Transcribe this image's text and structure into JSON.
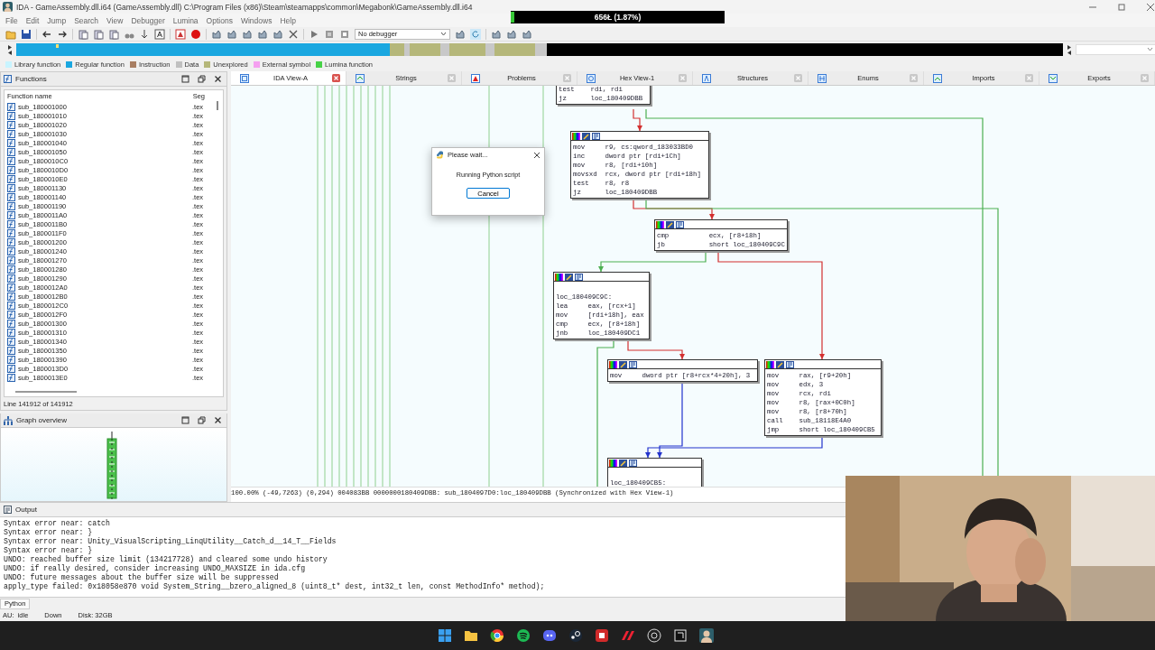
{
  "window": {
    "title": "IDA - GameAssembly.dll.i64 (GameAssembly.dll) C:\\Program Files (x86)\\Steam\\steamapps\\common\\Megabonk\\GameAssembly.dll.i64"
  },
  "overlay_counter": {
    "text": "656Ł (1.87%)",
    "level": 0.0187
  },
  "menu": [
    "File",
    "Edit",
    "Jump",
    "Search",
    "View",
    "Debugger",
    "Lumina",
    "Options",
    "Windows",
    "Help"
  ],
  "toolbar": {
    "debugger_select": "No debugger"
  },
  "legend": [
    {
      "label": "Library function",
      "color": "#c8f4ff"
    },
    {
      "label": "Regular function",
      "color": "#1aa7e0"
    },
    {
      "label": "Instruction",
      "color": "#a87e62"
    },
    {
      "label": "Data",
      "color": "#c0c0c0"
    },
    {
      "label": "Unexplored",
      "color": "#b5b77a"
    },
    {
      "label": "External symbol",
      "color": "#f5a0f0"
    },
    {
      "label": "Lumina function",
      "color": "#47d247"
    }
  ],
  "functions_panel": {
    "title": "Functions",
    "columns": [
      "Function name",
      "Seg"
    ],
    "rows": [
      {
        "name": "sub_180001000",
        "segment": ".tex"
      },
      {
        "name": "sub_180001010",
        "segment": ".tex"
      },
      {
        "name": "sub_180001020",
        "segment": ".tex"
      },
      {
        "name": "sub_180001030",
        "segment": ".tex"
      },
      {
        "name": "sub_180001040",
        "segment": ".tex"
      },
      {
        "name": "sub_180001050",
        "segment": ".tex"
      },
      {
        "name": "sub_1800010C0",
        "segment": ".tex"
      },
      {
        "name": "sub_1800010D0",
        "segment": ".tex"
      },
      {
        "name": "sub_1800010E0",
        "segment": ".tex"
      },
      {
        "name": "sub_180001130",
        "segment": ".tex"
      },
      {
        "name": "sub_180001140",
        "segment": ".tex"
      },
      {
        "name": "sub_180001190",
        "segment": ".tex"
      },
      {
        "name": "sub_1800011A0",
        "segment": ".tex"
      },
      {
        "name": "sub_1800011B0",
        "segment": ".tex"
      },
      {
        "name": "sub_1800011F0",
        "segment": ".tex"
      },
      {
        "name": "sub_180001200",
        "segment": ".tex"
      },
      {
        "name": "sub_180001240",
        "segment": ".tex"
      },
      {
        "name": "sub_180001270",
        "segment": ".tex"
      },
      {
        "name": "sub_180001280",
        "segment": ".tex"
      },
      {
        "name": "sub_180001290",
        "segment": ".tex"
      },
      {
        "name": "sub_1800012A0",
        "segment": ".tex"
      },
      {
        "name": "sub_1800012B0",
        "segment": ".tex"
      },
      {
        "name": "sub_1800012C0",
        "segment": ".tex"
      },
      {
        "name": "sub_1800012F0",
        "segment": ".tex"
      },
      {
        "name": "sub_180001300",
        "segment": ".tex"
      },
      {
        "name": "sub_180001310",
        "segment": ".tex"
      },
      {
        "name": "sub_180001340",
        "segment": ".tex"
      },
      {
        "name": "sub_180001350",
        "segment": ".tex"
      },
      {
        "name": "sub_180001390",
        "segment": ".tex"
      },
      {
        "name": "sub_1800013D0",
        "segment": ".tex"
      },
      {
        "name": "sub_1800013E0",
        "segment": ".tex"
      }
    ],
    "status": "Line 141912 of 141912"
  },
  "graph_overview": {
    "title": "Graph overview"
  },
  "tabs": [
    {
      "label": "IDA View-A",
      "selected": true
    },
    {
      "label": "Strings",
      "selected": false
    },
    {
      "label": "Problems",
      "selected": false
    },
    {
      "label": "Hex View-1",
      "selected": false
    },
    {
      "label": "Structures",
      "selected": false
    },
    {
      "label": "Enums",
      "selected": false
    },
    {
      "label": "Imports",
      "selected": false
    },
    {
      "label": "Exports",
      "selected": false
    }
  ],
  "graph": {
    "blocks": [
      {
        "header": false,
        "lines": [
          "test    rdi, rdi",
          "jz      loc_180409DBB"
        ]
      },
      {
        "header": true,
        "lines": [
          "mov     r9, cs:qword_183033BD0",
          "inc     dword ptr [rdi+1Ch]",
          "mov     r8, [rdi+10h]",
          "movsxd  rcx, dword ptr [rdi+18h]",
          "test    r8, r8",
          "jz      loc_180409DBB"
        ]
      },
      {
        "header": true,
        "lines": [
          "cmp          ecx, [r8+18h]",
          "jb           short loc_180409C9C"
        ]
      },
      {
        "header": true,
        "lines": [
          "loc_180409C9C:",
          "lea     eax, [rcx+1]",
          "mov     [rdi+18h], eax",
          "cmp     ecx, [r8+18h]",
          "jnb     loc_180409DC1"
        ]
      },
      {
        "header": true,
        "lines": [
          "mov     dword ptr [r8+rcx*4+20h], 3"
        ]
      },
      {
        "header": true,
        "lines": [
          "mov     rax, [r9+20h]",
          "mov     edx, 3",
          "mov     rcx, rdi",
          "mov     r8, [rax+0C0h]",
          "mov     r8, [r8+70h]",
          "call    sub_18118E4A0",
          "jmp     short loc_180409CB5"
        ]
      },
      {
        "header": true,
        "lines": [
          "loc_180409CB5:"
        ]
      }
    ],
    "edges": [
      {
        "kind": "false"
      },
      {
        "kind": "true"
      },
      {
        "kind": "false"
      },
      {
        "kind": "true"
      },
      {
        "kind": "true"
      },
      {
        "kind": "false"
      },
      {
        "kind": "false"
      },
      {
        "kind": "true"
      },
      {
        "kind": "jump"
      },
      {
        "kind": "jump"
      }
    ],
    "status": "100.00% (-49,7263) (0,294) 004083BB 0000000180409DBB: sub_1804097D0:loc_180409DBB (Synchronized with Hex View-1)"
  },
  "dialog": {
    "title": "Please wait...",
    "message": "Running Python script",
    "button": "Cancel"
  },
  "output": {
    "title": "Output",
    "lines": [
      "Syntax error near: catch",
      "Syntax error near: }",
      "Syntax error near: Unity_VisualScripting_LinqUtility__Catch_d__14_T__Fields",
      "Syntax error near: }",
      "UNDO: reached buffer size limit (134217728) and cleared some undo history",
      "UNDO: if really desired, consider increasing UNDO_MAXSIZE in ida.cfg",
      "UNDO: future messages about the buffer size will be suppressed",
      "apply_type failed: 0x18058e870 void System_String__bzero_aligned_8 (uint8_t* dest, int32_t len, const MethodInfo* method);"
    ],
    "input_label": "Python"
  },
  "status_bar": [
    "AU:  idle",
    "Down",
    "Disk: 32GB"
  ]
}
